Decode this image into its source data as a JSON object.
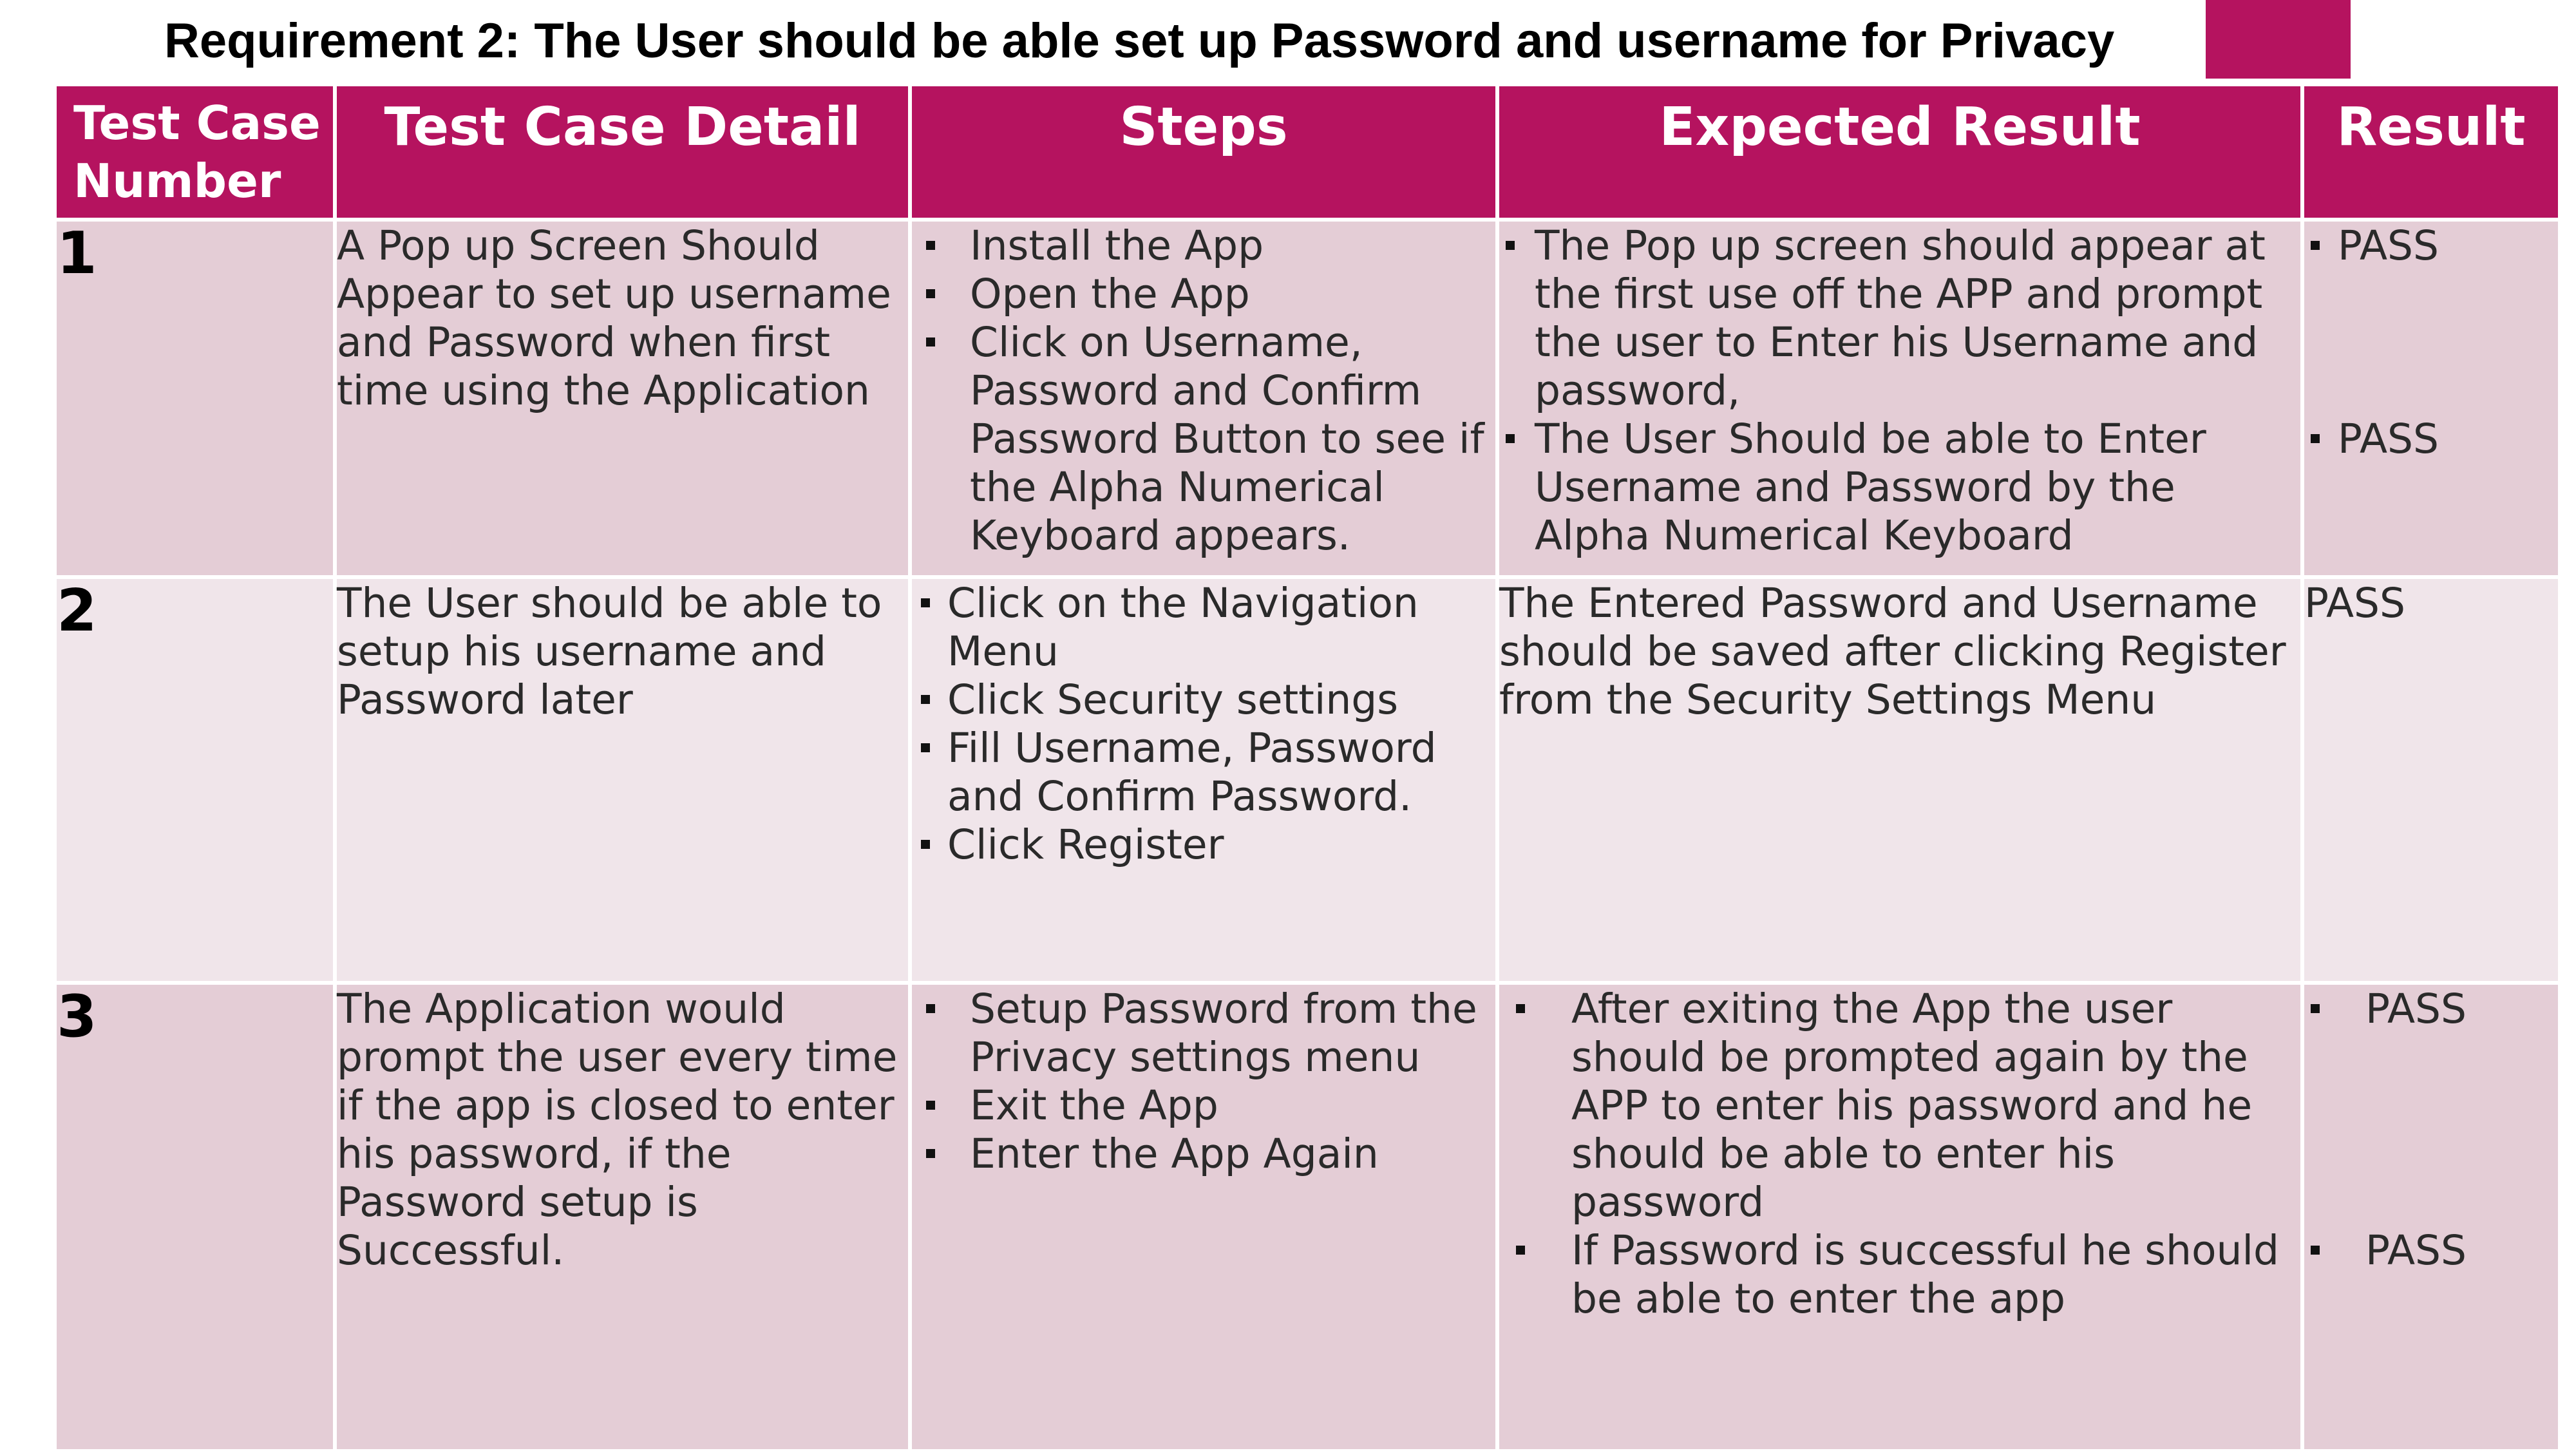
{
  "title": "Requirement 2: The User should be able set up Password and username for Privacy",
  "colors": {
    "header_bg": "#b5135f",
    "row_odd": "#e4cdd6",
    "row_even": "#f0e5ea"
  },
  "headers": [
    "Test Case Number",
    "Test Case Detail",
    "Steps",
    "Expected Result",
    "Result"
  ],
  "rows": [
    {
      "number": "1",
      "detail": "A Pop up Screen Should Appear to set up username and Password when first time using the Application",
      "steps": [
        "Install the App",
        "Open the App",
        "Click on Username, Password and Confirm Password Button to see if the Alpha Numerical Keyboard appears."
      ],
      "expected": [
        "The Pop up screen should appear at the first use off the APP and prompt the user to Enter his Username and password,",
        "The User Should be able to Enter Username and Password by the Alpha Numerical Keyboard"
      ],
      "results": [
        "PASS",
        "PASS"
      ]
    },
    {
      "number": "2",
      "detail": "The User should be able to setup his username and Password later",
      "steps": [
        "Click on the Navigation Menu",
        "Click Security settings",
        "Fill Username, Password and Confirm Password.",
        "Click Register"
      ],
      "expected_text": "The Entered Password and Username should be saved after clicking Register from the Security Settings Menu",
      "result_text": "PASS"
    },
    {
      "number": "3",
      "detail": "The Application would prompt the user every time if the app is closed to enter his password, if the Password setup is Successful.",
      "steps": [
        "Setup Password from the Privacy settings menu",
        "Exit the App",
        "Enter the App Again"
      ],
      "expected": [
        "After exiting the App the user should be prompted again by the APP to enter his password and he should be able to enter his password",
        "If Password is successful he should be able to enter the app"
      ],
      "results": [
        "PASS",
        "PASS"
      ]
    }
  ]
}
